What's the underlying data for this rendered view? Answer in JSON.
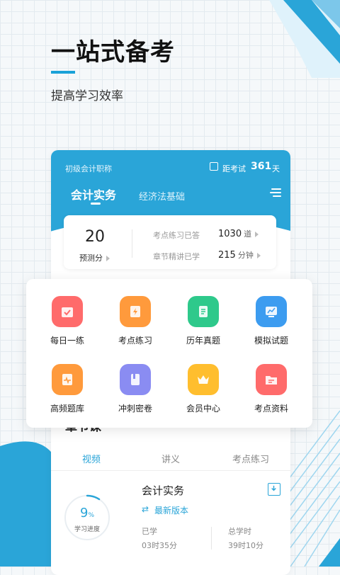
{
  "hero": {
    "title": "一站式备考",
    "subtitle": "提高学习效率"
  },
  "header": {
    "category": "初级会计职称",
    "exam_label": "距考试",
    "exam_days": "361",
    "exam_unit": "天",
    "tabs": [
      {
        "label": "会计实务",
        "active": true
      },
      {
        "label": "经济法基础",
        "active": false
      }
    ]
  },
  "stats": {
    "score": "20",
    "score_label": "预测分",
    "rows": [
      {
        "label": "考点练习已答",
        "value": "1030",
        "unit": "道"
      },
      {
        "label": "章节精讲已学",
        "value": "215",
        "unit": "分钟"
      }
    ]
  },
  "grid": {
    "items": [
      {
        "label": "每日一练",
        "icon": "calendar-check-icon",
        "color": "#ff6b6b"
      },
      {
        "label": "考点练习",
        "icon": "lightning-icon",
        "color": "#ff9a3c"
      },
      {
        "label": "历年真题",
        "icon": "document-icon",
        "color": "#2ec98b"
      },
      {
        "label": "模拟试题",
        "icon": "monitor-chart-icon",
        "color": "#3c9cf0"
      },
      {
        "label": "高频题库",
        "icon": "pulse-doc-icon",
        "color": "#ff9a3c"
      },
      {
        "label": "冲刺密卷",
        "icon": "book-icon",
        "color": "#8a8cf2"
      },
      {
        "label": "会员中心",
        "icon": "crown-icon",
        "color": "#ffbe2e"
      },
      {
        "label": "考点资料",
        "icon": "folder-icon",
        "color": "#ff6b6b"
      }
    ]
  },
  "section": {
    "title": "章节课",
    "tabs": [
      {
        "label": "视频",
        "active": true
      },
      {
        "label": "讲义",
        "active": false
      },
      {
        "label": "考点练习",
        "active": false
      }
    ]
  },
  "course": {
    "title": "会计实务",
    "version": "最新版本",
    "progress_pct": "9",
    "progress_unit": "%",
    "progress_label": "学习进度",
    "learned_label": "已学",
    "learned_value": "03时35分",
    "total_label": "总学时",
    "total_value": "39时10分"
  },
  "colors": {
    "accent": "#2aa5d8"
  }
}
